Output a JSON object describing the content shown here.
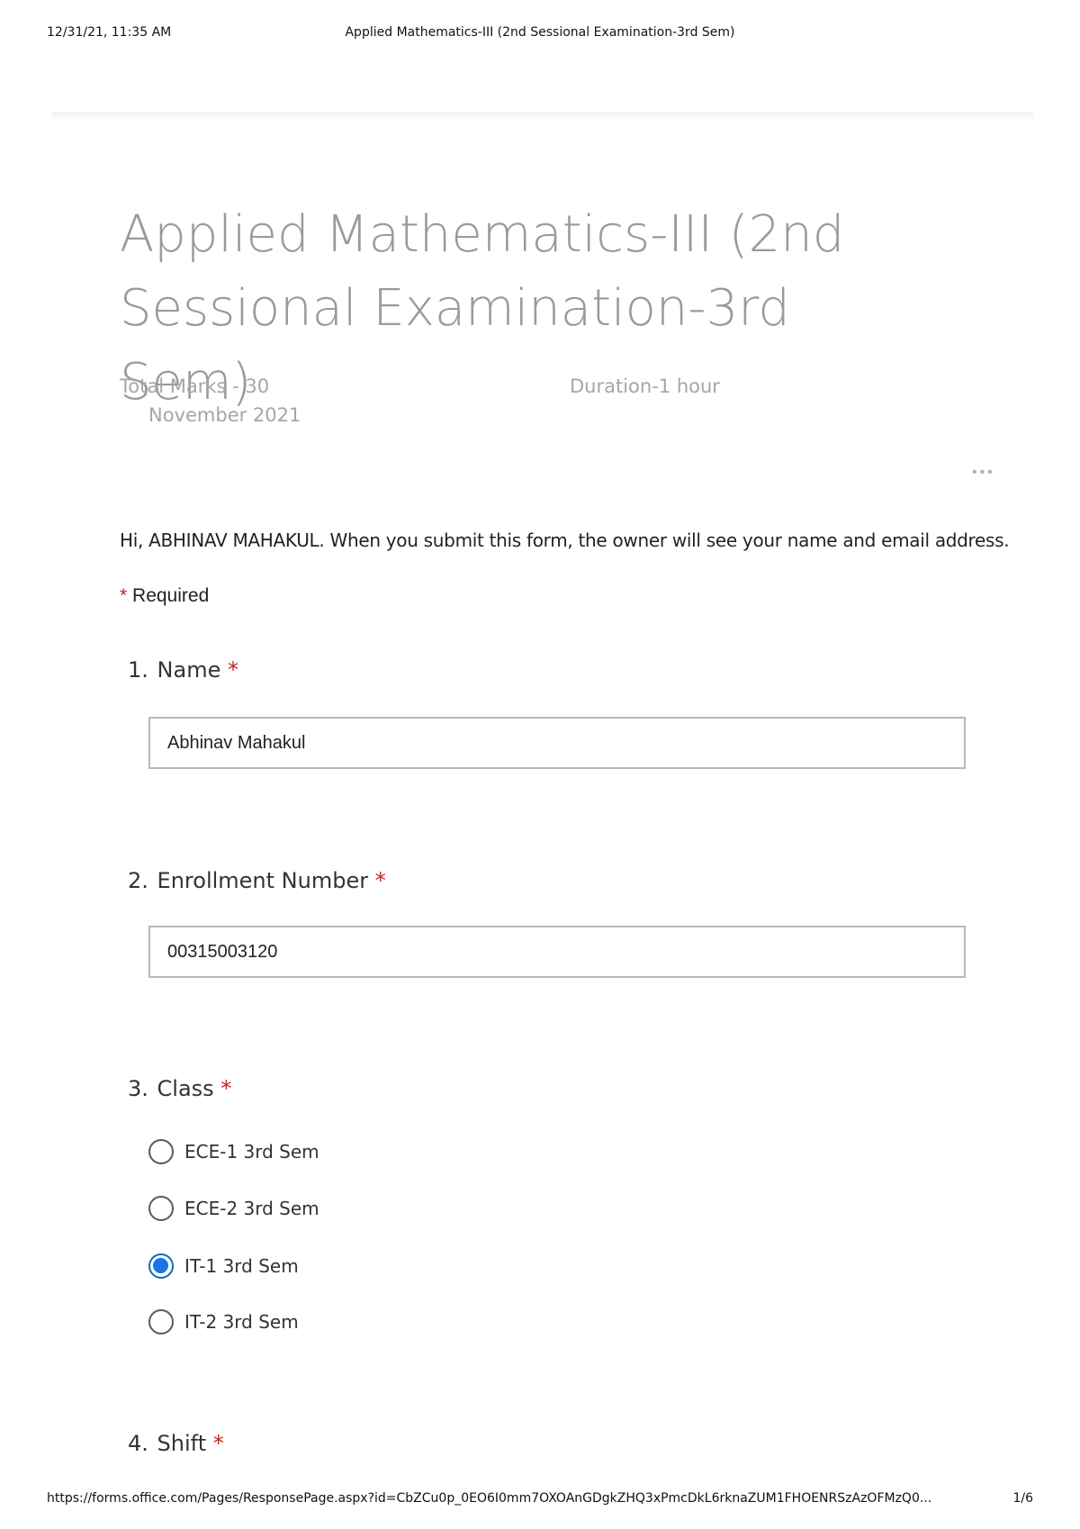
{
  "print_header": {
    "timestamp": "12/31/21, 11:35 AM",
    "title": "Applied Mathematics-III (2nd Sessional Examination-3rd Sem)"
  },
  "form": {
    "title_line1": "Applied Mathematics-III (2nd",
    "title_line2": "Sessional Examination-3rd Sem)",
    "description": {
      "total_marks": "Total Marks - 30",
      "duration": "Duration-1 hour",
      "date": "November 2021"
    },
    "notice": "Hi, ABHINAV MAHAKUL. When you submit this form, the owner will see your name and email address.",
    "required_star": "*",
    "required_label": "Required",
    "more_icon": "more-options-icon"
  },
  "questions": [
    {
      "number": "1.",
      "title": "Name",
      "required": "*",
      "answer": "Abhinav Mahakul"
    },
    {
      "number": "2.",
      "title": "Enrollment Number",
      "required": "*",
      "answer": "00315003120"
    },
    {
      "number": "3.",
      "title": "Class",
      "required": "*",
      "options": [
        "ECE-1 3rd Sem",
        "ECE-2 3rd Sem",
        "IT-1 3rd Sem",
        "IT-2 3rd Sem"
      ],
      "selected": "IT-1 3rd Sem"
    },
    {
      "number": "4.",
      "title": "Shift",
      "required": "*"
    }
  ],
  "print_footer": {
    "url": "https://forms.office.com/Pages/ResponsePage.aspx?id=CbZCu0p_0EO6I0mm7OXOAnGDgkZHQ3xPmcDkL6rknaZUM1FHOENRSzAzOFMzQ0...",
    "page": "1/6"
  },
  "colors": {
    "required_star": "#c2261e",
    "selected_radio": "#1a73e8",
    "title_gray": "#9a9a9a"
  }
}
